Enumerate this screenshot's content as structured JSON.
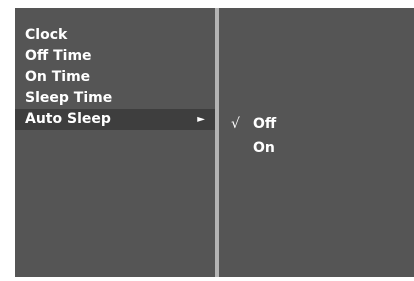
{
  "menu": {
    "items": [
      {
        "label": "Clock"
      },
      {
        "label": "Off Time"
      },
      {
        "label": "On Time"
      },
      {
        "label": "Sleep Time"
      },
      {
        "label": "Auto Sleep",
        "arrow": "►"
      }
    ],
    "selected_index": 4
  },
  "submenu": {
    "options": [
      {
        "label": "Off",
        "check": "√"
      },
      {
        "label": "On",
        "check": ""
      }
    ]
  },
  "colors": {
    "panel": "#555555",
    "highlight": "#3e3e3e",
    "divider": "#b4b4b4",
    "text": "#ffffff"
  }
}
